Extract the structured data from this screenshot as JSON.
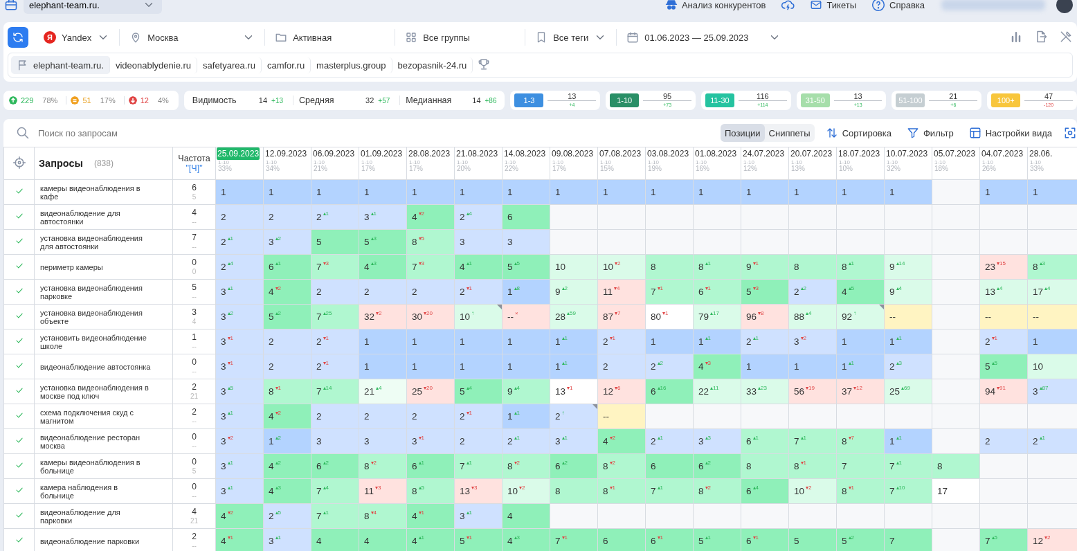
{
  "top_bar": {
    "project": "elephant-team.ru.",
    "links": [
      {
        "kind": "spy",
        "label": "Анализ конкурентов"
      },
      {
        "kind": "cloud"
      },
      {
        "kind": "mail",
        "label": "Тикеты"
      },
      {
        "kind": "help",
        "label": "Справка"
      }
    ]
  },
  "toolbar": {
    "engine_logo": "Я",
    "engine": "Yandex",
    "region": "Москва",
    "status": "Активная",
    "groups": "Все группы",
    "tags": "Все теги",
    "period": "01.06.2023 — 25.09.2023"
  },
  "competitors": [
    {
      "label": "elephant-team.ru.",
      "selected": true
    },
    {
      "label": "videonablydenie.ru",
      "selected": false
    },
    {
      "label": "safetyarea.ru",
      "selected": false
    },
    {
      "label": "camfor.ru",
      "selected": false
    },
    {
      "label": "masterplus.group",
      "selected": false
    },
    {
      "label": "bezopasnik-24.ru",
      "selected": false
    }
  ],
  "movement": [
    {
      "kind": "up",
      "count": "229",
      "share": "78%"
    },
    {
      "kind": "flat",
      "count": "51",
      "share": "17%"
    },
    {
      "kind": "down",
      "count": "12",
      "share": "4%"
    }
  ],
  "metrics": [
    {
      "label": "Видимость",
      "value": "14",
      "delta": "+13"
    },
    {
      "label": "Средняя",
      "value": "32",
      "delta": "+57"
    },
    {
      "label": "Медианная",
      "value": "14",
      "delta": "+86"
    }
  ],
  "ranges": [
    {
      "label": "1-3",
      "color": "#3d8fe0",
      "count": "13",
      "delta": "+4",
      "up": true
    },
    {
      "label": "1-10",
      "color": "#2a8f66",
      "count": "95",
      "delta": "+73",
      "up": true
    },
    {
      "label": "11-30",
      "color": "#25c3a0",
      "count": "116",
      "delta": "+114",
      "up": true
    },
    {
      "label": "31-50",
      "color": "#a6deaa",
      "count": "13",
      "delta": "+13",
      "up": true
    },
    {
      "label": "51-100",
      "color": "#c5ced2",
      "count": "21",
      "delta": "+6",
      "up": true
    },
    {
      "label": "100+",
      "color": "#f8c63c",
      "count": "47",
      "delta": "-120",
      "up": false
    }
  ],
  "search": {
    "placeholder": "Поиск по запросам"
  },
  "view_tabs": [
    {
      "label": "Позиции",
      "selected": true
    },
    {
      "label": "Сниппеты",
      "selected": false
    }
  ],
  "actions": [
    {
      "kind": "sort",
      "label": "Сортировка"
    },
    {
      "kind": "filter",
      "label": "Фильтр"
    },
    {
      "kind": "layout",
      "label": "Настройки вида"
    }
  ],
  "table": {
    "query_title": "Запросы",
    "query_count": "(838)",
    "freq_title": "Частота",
    "freq_sub": "\"[Ч]\"",
    "columns": [
      {
        "date": "25.09.2023",
        "range": "1-10",
        "share": "33%",
        "selected": true
      },
      {
        "date": "12.09.2023",
        "range": "1-10",
        "share": "34%",
        "selected": false
      },
      {
        "date": "06.09.2023",
        "range": "1-10",
        "share": "21%",
        "selected": false
      },
      {
        "date": "01.09.2023",
        "range": "1-10",
        "share": "17%",
        "selected": false
      },
      {
        "date": "28.08.2023",
        "range": "1-10",
        "share": "17%",
        "selected": false
      },
      {
        "date": "21.08.2023",
        "range": "1-10",
        "share": "20%",
        "selected": false
      },
      {
        "date": "14.08.2023",
        "range": "1-10",
        "share": "22%",
        "selected": false
      },
      {
        "date": "09.08.2023",
        "range": "1-10",
        "share": "17%",
        "selected": false
      },
      {
        "date": "07.08.2023",
        "range": "1-10",
        "share": "15%",
        "selected": false
      },
      {
        "date": "03.08.2023",
        "range": "1-10",
        "share": "19%",
        "selected": false
      },
      {
        "date": "01.08.2023",
        "range": "1-10",
        "share": "16%",
        "selected": false
      },
      {
        "date": "24.07.2023",
        "range": "1-10",
        "share": "12%",
        "selected": false
      },
      {
        "date": "20.07.2023",
        "range": "1-10",
        "share": "13%",
        "selected": false
      },
      {
        "date": "18.07.2023",
        "range": "1-10",
        "share": "10%",
        "selected": false
      },
      {
        "date": "10.07.2023",
        "range": "1-10",
        "share": "32%",
        "selected": false
      },
      {
        "date": "05.07.2023",
        "range": "1-10",
        "share": "18%",
        "selected": false
      },
      {
        "date": "04.07.2023",
        "range": "1-10",
        "share": "26%",
        "selected": false
      },
      {
        "date": "28.06.",
        "range": "1-10",
        "share": "33%",
        "selected": false
      }
    ],
    "rows": [
      {
        "query": "камеры видеонаблюдения в кафе",
        "freq": "6",
        "freq_exact": "5",
        "cells": [
          {
            "v": "1",
            "color": "#b3d3ff"
          },
          {
            "v": "1",
            "color": "#b3d3ff"
          },
          {
            "v": "1",
            "color": "#b3d3ff"
          },
          {
            "v": "1",
            "color": "#b3d3ff"
          },
          {
            "v": "1",
            "color": "#b3d3ff"
          },
          {
            "v": "1",
            "color": "#b3d3ff"
          },
          {
            "v": "1",
            "color": "#b3d3ff"
          },
          {
            "v": "1",
            "color": "#b3d3ff"
          },
          {
            "v": "1",
            "color": "#b3d3ff"
          },
          {
            "v": "1",
            "color": "#b3d3ff"
          },
          {
            "v": "1",
            "color": "#b3d3ff"
          },
          {
            "v": "1",
            "color": "#b3d3ff"
          },
          {
            "v": "1",
            "color": "#b3d3ff"
          },
          {
            "v": "1",
            "color": "#b3d3ff"
          },
          {
            "v": "1",
            "color": "#b3d3ff"
          },
          {
            "color": "#f7f8fa"
          },
          {
            "v": "1",
            "color": "#b3d3ff"
          },
          {
            "v": "1",
            "color": "#b3d3ff"
          }
        ]
      },
      {
        "query": "видеонаблюдение для автостоянки",
        "freq": "4",
        "freq_exact": "--",
        "cells": [
          {
            "v": "2",
            "color": "#cfe1ff"
          },
          {
            "v": "2",
            "color": "#cfe1ff"
          },
          {
            "v": "2",
            "d": "▴1",
            "up": true,
            "color": "#cfe1ff"
          },
          {
            "v": "3",
            "d": "▴1",
            "up": true,
            "color": "#cfe1ff"
          },
          {
            "v": "4",
            "d": "▾2",
            "up": false,
            "color": "#8ff0b9"
          },
          {
            "v": "2",
            "d": "▴4",
            "up": true,
            "color": "#cfe1ff"
          },
          {
            "v": "6",
            "color": "#8ff0b9"
          },
          {
            "color": "#f7f8fa"
          },
          {
            "color": "#f7f8fa"
          },
          {
            "color": "#f7f8fa"
          },
          {
            "color": "#f7f8fa"
          },
          {
            "color": "#f7f8fa"
          },
          {
            "color": "#f7f8fa"
          },
          {
            "color": "#f7f8fa"
          },
          {
            "color": "#f7f8fa"
          },
          {
            "color": "#f7f8fa"
          },
          {
            "color": "#f7f8fa"
          },
          {
            "color": "#f7f8fa"
          }
        ]
      },
      {
        "query": "установка видеонаблюдения для автостоянки",
        "freq": "7",
        "freq_exact": "--",
        "cells": [
          {
            "v": "2",
            "d": "▴1",
            "up": true,
            "color": "#cfe1ff"
          },
          {
            "v": "3",
            "d": "▴2",
            "up": true,
            "color": "#cfe1ff"
          },
          {
            "v": "5",
            "color": "#8ff0b9"
          },
          {
            "v": "5",
            "d": "▴3",
            "up": true,
            "color": "#8ff0b9"
          },
          {
            "v": "8",
            "d": "▾5",
            "up": false,
            "color": "#b0f7d0"
          },
          {
            "v": "3",
            "color": "#cfe1ff"
          },
          {
            "v": "3",
            "color": "#cfe1ff"
          },
          {
            "color": "#f7f8fa"
          },
          {
            "color": "#f7f8fa"
          },
          {
            "color": "#f7f8fa"
          },
          {
            "color": "#f7f8fa"
          },
          {
            "color": "#f7f8fa"
          },
          {
            "color": "#f7f8fa"
          },
          {
            "color": "#f7f8fa"
          },
          {
            "color": "#f7f8fa"
          },
          {
            "color": "#f7f8fa"
          },
          {
            "color": "#f7f8fa"
          },
          {
            "color": "#f7f8fa"
          }
        ]
      },
      {
        "query": "периметр камеры",
        "freq": "0",
        "freq_exact": "0",
        "cells": [
          {
            "v": "2",
            "d": "▴4",
            "up": true,
            "color": "#cfe1ff"
          },
          {
            "v": "6",
            "d": "▴1",
            "up": true,
            "color": "#8ff0b9"
          },
          {
            "v": "7",
            "d": "▾3",
            "up": false,
            "color": "#b0f7d0"
          },
          {
            "v": "4",
            "d": "▴3",
            "up": true,
            "color": "#8ff0b9"
          },
          {
            "v": "7",
            "d": "▾3",
            "up": false,
            "color": "#b0f7d0"
          },
          {
            "v": "4",
            "d": "▴1",
            "up": true,
            "color": "#8ff0b9"
          },
          {
            "v": "5",
            "d": "▴5",
            "up": true,
            "color": "#8ff0b9"
          },
          {
            "v": "10",
            "color": "#dafbe9"
          },
          {
            "v": "10",
            "d": "▾2",
            "up": false,
            "color": "#dafbe9"
          },
          {
            "v": "8",
            "color": "#b0f7d0"
          },
          {
            "v": "8",
            "d": "▴1",
            "up": true,
            "color": "#b0f7d0"
          },
          {
            "v": "9",
            "d": "▾1",
            "up": false,
            "color": "#b0f7d0"
          },
          {
            "v": "8",
            "color": "#b0f7d0"
          },
          {
            "v": "8",
            "d": "▴1",
            "up": true,
            "color": "#b0f7d0"
          },
          {
            "v": "9",
            "d": "▴14",
            "up": true,
            "color": "#dafbe9"
          },
          {
            "color": "#f7f8fa"
          },
          {
            "v": "23",
            "d": "▾15",
            "up": false,
            "color": "#ffe2df"
          },
          {
            "v": "8",
            "d": "▴3",
            "up": true,
            "color": "#b0f7d0"
          }
        ]
      },
      {
        "query": "установка видеонаблюдения парковке",
        "freq": "5",
        "freq_exact": "--",
        "cells": [
          {
            "v": "3",
            "d": "▴1",
            "up": true,
            "color": "#cfe1ff"
          },
          {
            "v": "4",
            "d": "▾2",
            "up": false,
            "color": "#8ff0b9"
          },
          {
            "v": "2",
            "color": "#cfe1ff"
          },
          {
            "v": "2",
            "color": "#cfe1ff"
          },
          {
            "v": "2",
            "color": "#cfe1ff"
          },
          {
            "v": "2",
            "d": "▾1",
            "up": false,
            "color": "#cfe1ff"
          },
          {
            "v": "1",
            "d": "▴8",
            "up": true,
            "color": "#b3d3ff"
          },
          {
            "v": "9",
            "d": "▴2",
            "up": true,
            "color": "#dafbe9"
          },
          {
            "v": "11",
            "d": "▾4",
            "up": false,
            "color": "#ffe2df"
          },
          {
            "v": "7",
            "d": "▾1",
            "up": false,
            "color": "#b0f7d0"
          },
          {
            "v": "6",
            "d": "▾1",
            "up": false,
            "color": "#b0f7d0"
          },
          {
            "v": "5",
            "d": "▾3",
            "up": false,
            "color": "#8ff0b9"
          },
          {
            "v": "2",
            "d": "▴2",
            "up": true,
            "color": "#cfe1ff"
          },
          {
            "v": "4",
            "d": "▴5",
            "up": true,
            "color": "#8ff0b9"
          },
          {
            "v": "9",
            "d": "▴4",
            "up": true,
            "color": "#dafbe9"
          },
          {
            "color": "#f7f8fa"
          },
          {
            "v": "13",
            "d": "▴4",
            "up": true,
            "color": "#dafbe9"
          },
          {
            "v": "17",
            "d": "▴4",
            "up": true,
            "color": "#dafbe9"
          }
        ]
      },
      {
        "query": "установка видеонаблюдения объекте",
        "freq": "3",
        "freq_exact": "4",
        "cells": [
          {
            "v": "3",
            "d": "▴2",
            "up": true,
            "color": "#cfe1ff"
          },
          {
            "v": "5",
            "d": "▴2",
            "up": true,
            "color": "#8ff0b9"
          },
          {
            "v": "7",
            "d": "▴25",
            "up": true,
            "color": "#b0f7d0"
          },
          {
            "v": "32",
            "d": "▾2",
            "up": false,
            "color": "#ffe2df"
          },
          {
            "v": "30",
            "d": "▾20",
            "up": false,
            "color": "#ffe2df"
          },
          {
            "v": "10",
            "d": "↑",
            "up": true,
            "flag": true,
            "color": "#dafbe9"
          },
          {
            "v": "--",
            "d": "×",
            "up": false,
            "color": "#ffe2df"
          },
          {
            "v": "28",
            "d": "▴59",
            "up": true,
            "color": "#dafbe9"
          },
          {
            "v": "87",
            "d": "▾7",
            "up": false,
            "color": "#ffe2df"
          },
          {
            "v": "80",
            "d": "▾1",
            "up": false,
            "color": "#ffffff"
          },
          {
            "v": "79",
            "d": "▴17",
            "up": true,
            "color": "#dafbe9"
          },
          {
            "v": "96",
            "d": "▾8",
            "up": false,
            "color": "#ffe2df"
          },
          {
            "v": "88",
            "d": "▴4",
            "up": true,
            "color": "#dafbe9"
          },
          {
            "v": "92",
            "d": "↑",
            "up": true,
            "flag": true,
            "color": "#dafbe9"
          },
          {
            "v": "--",
            "color": "#fff4c2"
          },
          {
            "color": "#f7f8fa"
          },
          {
            "v": "--",
            "color": "#fff4c2"
          },
          {
            "v": "--",
            "color": "#fff4c2"
          }
        ]
      },
      {
        "query": "установить видеонаблюдение школе",
        "freq": "1",
        "freq_exact": "--",
        "cells": [
          {
            "v": "3",
            "d": "▾1",
            "up": false,
            "color": "#cfe1ff"
          },
          {
            "v": "2",
            "color": "#cfe1ff"
          },
          {
            "v": "2",
            "d": "▾1",
            "up": false,
            "color": "#cfe1ff"
          },
          {
            "v": "1",
            "color": "#b3d3ff"
          },
          {
            "v": "1",
            "color": "#b3d3ff"
          },
          {
            "v": "1",
            "color": "#b3d3ff"
          },
          {
            "v": "1",
            "color": "#b3d3ff"
          },
          {
            "v": "1",
            "d": "▴1",
            "up": true,
            "color": "#b3d3ff"
          },
          {
            "v": "2",
            "d": "▾1",
            "up": false,
            "color": "#cfe1ff"
          },
          {
            "v": "1",
            "color": "#b3d3ff"
          },
          {
            "v": "1",
            "d": "▴1",
            "up": true,
            "color": "#b3d3ff"
          },
          {
            "v": "2",
            "d": "▴1",
            "up": true,
            "color": "#cfe1ff"
          },
          {
            "v": "3",
            "d": "▾2",
            "up": false,
            "color": "#cfe1ff"
          },
          {
            "v": "1",
            "color": "#b3d3ff"
          },
          {
            "v": "1",
            "d": "▴1",
            "up": true,
            "color": "#b3d3ff"
          },
          {
            "color": "#f7f8fa"
          },
          {
            "v": "2",
            "d": "▾1",
            "up": false,
            "color": "#cfe1ff"
          },
          {
            "v": "1",
            "color": "#b3d3ff"
          }
        ]
      },
      {
        "query": "видеонаблюдение автостоянка",
        "freq": "0",
        "freq_exact": "--",
        "cells": [
          {
            "v": "3",
            "d": "▾1",
            "up": false,
            "color": "#cfe1ff"
          },
          {
            "v": "2",
            "color": "#cfe1ff"
          },
          {
            "v": "2",
            "d": "▾1",
            "up": false,
            "color": "#cfe1ff"
          },
          {
            "v": "1",
            "color": "#b3d3ff"
          },
          {
            "v": "1",
            "color": "#b3d3ff"
          },
          {
            "v": "1",
            "color": "#b3d3ff"
          },
          {
            "v": "1",
            "color": "#b3d3ff"
          },
          {
            "v": "1",
            "d": "▴1",
            "up": true,
            "color": "#b3d3ff"
          },
          {
            "v": "2",
            "color": "#cfe1ff"
          },
          {
            "v": "2",
            "d": "▴2",
            "up": true,
            "color": "#cfe1ff"
          },
          {
            "v": "4",
            "d": "▾3",
            "up": false,
            "color": "#8ff0b9"
          },
          {
            "v": "1",
            "color": "#b3d3ff"
          },
          {
            "v": "1",
            "color": "#b3d3ff"
          },
          {
            "v": "1",
            "d": "▴1",
            "up": true,
            "color": "#b3d3ff"
          },
          {
            "v": "2",
            "d": "▴3",
            "up": true,
            "color": "#cfe1ff"
          },
          {
            "color": "#f7f8fa"
          },
          {
            "v": "5",
            "d": "▴5",
            "up": true,
            "color": "#8ff0b9"
          },
          {
            "v": "10",
            "color": "#dafbe9"
          }
        ]
      },
      {
        "query": "установка видеонаблюдения в москве под ключ",
        "freq": "2",
        "freq_exact": "21",
        "cells": [
          {
            "v": "3",
            "d": "▴5",
            "up": true,
            "color": "#cfe1ff"
          },
          {
            "v": "8",
            "d": "▾1",
            "up": false,
            "color": "#b0f7d0"
          },
          {
            "v": "7",
            "d": "▴14",
            "up": true,
            "color": "#b0f7d0"
          },
          {
            "v": "21",
            "d": "▴4",
            "up": true,
            "color": "#eefdf4"
          },
          {
            "v": "25",
            "d": "▾20",
            "up": false,
            "color": "#ffe2df"
          },
          {
            "v": "5",
            "d": "▴4",
            "up": true,
            "color": "#8ff0b9"
          },
          {
            "v": "9",
            "d": "▴4",
            "up": true,
            "color": "#b0f7d0"
          },
          {
            "v": "13",
            "d": "▾1",
            "up": false,
            "color": "#ffffff"
          },
          {
            "v": "12",
            "d": "▾6",
            "up": false,
            "color": "#ffe2df"
          },
          {
            "v": "6",
            "d": "▴16",
            "up": true,
            "color": "#8ff0b9"
          },
          {
            "v": "22",
            "d": "▴11",
            "up": true,
            "color": "#dafbe9"
          },
          {
            "v": "33",
            "d": "▴23",
            "up": true,
            "color": "#dafbe9"
          },
          {
            "v": "56",
            "d": "▾19",
            "up": false,
            "color": "#ffe2df"
          },
          {
            "v": "37",
            "d": "▾12",
            "up": false,
            "color": "#ffe2df"
          },
          {
            "v": "25",
            "d": "▴69",
            "up": true,
            "color": "#dafbe9"
          },
          {
            "color": "#f7f8fa"
          },
          {
            "v": "94",
            "d": "▾91",
            "up": false,
            "color": "#ffe2df"
          },
          {
            "v": "3",
            "d": "▴87",
            "up": true,
            "color": "#cfe1ff"
          }
        ]
      },
      {
        "query": "схема подключения скуд с магнитом",
        "freq": "2",
        "freq_exact": "--",
        "cells": [
          {
            "v": "3",
            "d": "▴1",
            "up": true,
            "color": "#cfe1ff"
          },
          {
            "v": "4",
            "d": "▾2",
            "up": false,
            "color": "#8ff0b9"
          },
          {
            "v": "2",
            "color": "#cfe1ff"
          },
          {
            "v": "2",
            "color": "#cfe1ff"
          },
          {
            "v": "2",
            "color": "#cfe1ff"
          },
          {
            "v": "2",
            "d": "▾1",
            "up": false,
            "color": "#cfe1ff"
          },
          {
            "v": "1",
            "d": "▴1",
            "up": true,
            "color": "#b3d3ff"
          },
          {
            "v": "2",
            "d": "↑",
            "up": true,
            "flag": true,
            "color": "#cfe1ff"
          },
          {
            "v": "--",
            "color": "#fff4c2"
          },
          {
            "color": "#f7f8fa"
          },
          {
            "color": "#f7f8fa"
          },
          {
            "color": "#f7f8fa"
          },
          {
            "color": "#f7f8fa"
          },
          {
            "color": "#f7f8fa"
          },
          {
            "color": "#f7f8fa"
          },
          {
            "color": "#f7f8fa"
          },
          {
            "color": "#f7f8fa"
          },
          {
            "color": "#f7f8fa"
          }
        ]
      },
      {
        "query": "видеонаблюдение ресторан москва",
        "freq": "0",
        "freq_exact": "--",
        "cells": [
          {
            "v": "3",
            "d": "▾2",
            "up": false,
            "color": "#cfe1ff"
          },
          {
            "v": "1",
            "d": "▴2",
            "up": true,
            "color": "#b3d3ff"
          },
          {
            "v": "3",
            "color": "#cfe1ff"
          },
          {
            "v": "3",
            "color": "#cfe1ff"
          },
          {
            "v": "3",
            "d": "▾1",
            "up": false,
            "color": "#cfe1ff"
          },
          {
            "v": "2",
            "color": "#cfe1ff"
          },
          {
            "v": "2",
            "d": "▴1",
            "up": true,
            "color": "#cfe1ff"
          },
          {
            "v": "3",
            "d": "▴1",
            "up": true,
            "color": "#cfe1ff"
          },
          {
            "v": "4",
            "d": "▾2",
            "up": false,
            "color": "#8ff0b9"
          },
          {
            "v": "2",
            "d": "▴1",
            "up": true,
            "color": "#cfe1ff"
          },
          {
            "v": "3",
            "d": "▴3",
            "up": true,
            "color": "#cfe1ff"
          },
          {
            "v": "6",
            "d": "▴1",
            "up": true,
            "color": "#b0f7d0"
          },
          {
            "v": "7",
            "d": "▴1",
            "up": true,
            "color": "#b0f7d0"
          },
          {
            "v": "8",
            "d": "▾7",
            "up": false,
            "color": "#b0f7d0"
          },
          {
            "v": "1",
            "d": "▴1",
            "up": true,
            "color": "#b3d3ff"
          },
          {
            "color": "#f7f8fa"
          },
          {
            "v": "2",
            "color": "#cfe1ff"
          },
          {
            "v": "2",
            "d": "▴1",
            "up": true,
            "color": "#cfe1ff"
          }
        ]
      },
      {
        "query": "камеры видеонаблюдения в больнице",
        "freq": "0",
        "freq_exact": "5",
        "cells": [
          {
            "v": "3",
            "d": "▴1",
            "up": true,
            "color": "#cfe1ff"
          },
          {
            "v": "4",
            "d": "▴2",
            "up": true,
            "color": "#8ff0b9"
          },
          {
            "v": "6",
            "d": "▴2",
            "up": true,
            "color": "#8ff0b9"
          },
          {
            "v": "8",
            "d": "▾2",
            "up": false,
            "color": "#b0f7d0"
          },
          {
            "v": "6",
            "d": "▴1",
            "up": true,
            "color": "#8ff0b9"
          },
          {
            "v": "7",
            "d": "▴1",
            "up": true,
            "color": "#b0f7d0"
          },
          {
            "v": "8",
            "d": "▾2",
            "up": false,
            "color": "#b0f7d0"
          },
          {
            "v": "6",
            "d": "▴2",
            "up": true,
            "color": "#8ff0b9"
          },
          {
            "v": "8",
            "d": "▾2",
            "up": false,
            "color": "#b0f7d0"
          },
          {
            "v": "6",
            "color": "#8ff0b9"
          },
          {
            "v": "6",
            "d": "▴2",
            "up": true,
            "color": "#8ff0b9"
          },
          {
            "v": "8",
            "color": "#b0f7d0"
          },
          {
            "v": "8",
            "d": "▾1",
            "up": false,
            "color": "#b0f7d0"
          },
          {
            "v": "7",
            "color": "#b0f7d0"
          },
          {
            "v": "7",
            "d": "▴1",
            "up": true,
            "color": "#b0f7d0"
          },
          {
            "v": "8",
            "color": "#b0f7d0"
          },
          {
            "color": "#f7f8fa"
          },
          {
            "color": "#f7f8fa"
          }
        ]
      },
      {
        "query": "камера наблюдения в больнице",
        "freq": "0",
        "freq_exact": "--",
        "cells": [
          {
            "v": "3",
            "d": "▴1",
            "up": true,
            "color": "#cfe1ff"
          },
          {
            "v": "4",
            "d": "▴3",
            "up": true,
            "color": "#8ff0b9"
          },
          {
            "v": "7",
            "d": "▴4",
            "up": true,
            "color": "#b0f7d0"
          },
          {
            "v": "11",
            "d": "▾3",
            "up": false,
            "color": "#ffe2df"
          },
          {
            "v": "8",
            "d": "▴5",
            "up": true,
            "color": "#b0f7d0"
          },
          {
            "v": "13",
            "d": "▾3",
            "up": false,
            "color": "#ffe2df"
          },
          {
            "v": "10",
            "d": "▾2",
            "up": false,
            "color": "#dafbe9"
          },
          {
            "v": "8",
            "color": "#b0f7d0"
          },
          {
            "v": "8",
            "d": "▾1",
            "up": false,
            "color": "#b0f7d0"
          },
          {
            "v": "7",
            "d": "▴1",
            "up": true,
            "color": "#b0f7d0"
          },
          {
            "v": "8",
            "d": "▾2",
            "up": false,
            "color": "#b0f7d0"
          },
          {
            "v": "6",
            "d": "▴4",
            "up": true,
            "color": "#8ff0b9"
          },
          {
            "v": "10",
            "d": "▾2",
            "up": false,
            "color": "#dafbe9"
          },
          {
            "v": "8",
            "d": "▾1",
            "up": false,
            "color": "#b0f7d0"
          },
          {
            "v": "7",
            "d": "▴10",
            "up": true,
            "color": "#b0f7d0"
          },
          {
            "v": "17",
            "color": "#ffffff"
          },
          {
            "color": "#f7f8fa"
          },
          {
            "color": "#f7f8fa"
          }
        ]
      },
      {
        "query": "видеонаблюдение для парковки",
        "freq": "4",
        "freq_exact": "21",
        "cells": [
          {
            "v": "4",
            "d": "▾2",
            "up": false,
            "color": "#8ff0b9"
          },
          {
            "v": "2",
            "d": "▴5",
            "up": true,
            "color": "#cfe1ff"
          },
          {
            "v": "7",
            "d": "▴1",
            "up": true,
            "color": "#b0f7d0"
          },
          {
            "v": "8",
            "d": "▾4",
            "up": false,
            "color": "#b0f7d0"
          },
          {
            "v": "4",
            "d": "▾1",
            "up": false,
            "color": "#8ff0b9"
          },
          {
            "v": "3",
            "d": "▴1",
            "up": true,
            "color": "#cfe1ff"
          },
          {
            "v": "4",
            "color": "#8ff0b9"
          },
          {
            "color": "#f7f8fa"
          },
          {
            "color": "#f7f8fa"
          },
          {
            "color": "#f7f8fa"
          },
          {
            "color": "#f7f8fa"
          },
          {
            "color": "#f7f8fa"
          },
          {
            "color": "#f7f8fa"
          },
          {
            "color": "#f7f8fa"
          },
          {
            "color": "#f7f8fa"
          },
          {
            "color": "#f7f8fa"
          },
          {
            "color": "#f7f8fa"
          },
          {
            "color": "#f7f8fa"
          }
        ]
      },
      {
        "query": "видеонаблюдение парковки",
        "freq": "2",
        "freq_exact": "--",
        "cells": [
          {
            "v": "4",
            "d": "▾1",
            "up": false,
            "color": "#8ff0b9"
          },
          {
            "v": "3",
            "d": "▴1",
            "up": true,
            "color": "#cfe1ff"
          },
          {
            "v": "4",
            "color": "#8ff0b9"
          },
          {
            "v": "4",
            "color": "#8ff0b9"
          },
          {
            "v": "4",
            "d": "▴1",
            "up": true,
            "color": "#8ff0b9"
          },
          {
            "v": "5",
            "d": "▾1",
            "up": false,
            "color": "#8ff0b9"
          },
          {
            "v": "4",
            "d": "▴3",
            "up": true,
            "color": "#8ff0b9"
          },
          {
            "v": "7",
            "d": "▾1",
            "up": false,
            "color": "#8ff0b9"
          },
          {
            "v": "6",
            "color": "#8ff0b9"
          },
          {
            "v": "6",
            "d": "▾1",
            "up": false,
            "color": "#8ff0b9"
          },
          {
            "v": "5",
            "d": "▴1",
            "up": true,
            "color": "#8ff0b9"
          },
          {
            "v": "6",
            "d": "▾1",
            "up": false,
            "color": "#8ff0b9"
          },
          {
            "v": "5",
            "color": "#8ff0b9"
          },
          {
            "v": "5",
            "d": "▴2",
            "up": true,
            "color": "#8ff0b9"
          },
          {
            "v": "7",
            "color": "#8ff0b9"
          },
          {
            "color": "#f7f8fa"
          },
          {
            "v": "7",
            "d": "▴5",
            "up": true,
            "color": "#8ff0b9"
          },
          {
            "v": "12",
            "d": "▾2",
            "up": false,
            "color": "#ffe2df"
          }
        ]
      }
    ]
  }
}
